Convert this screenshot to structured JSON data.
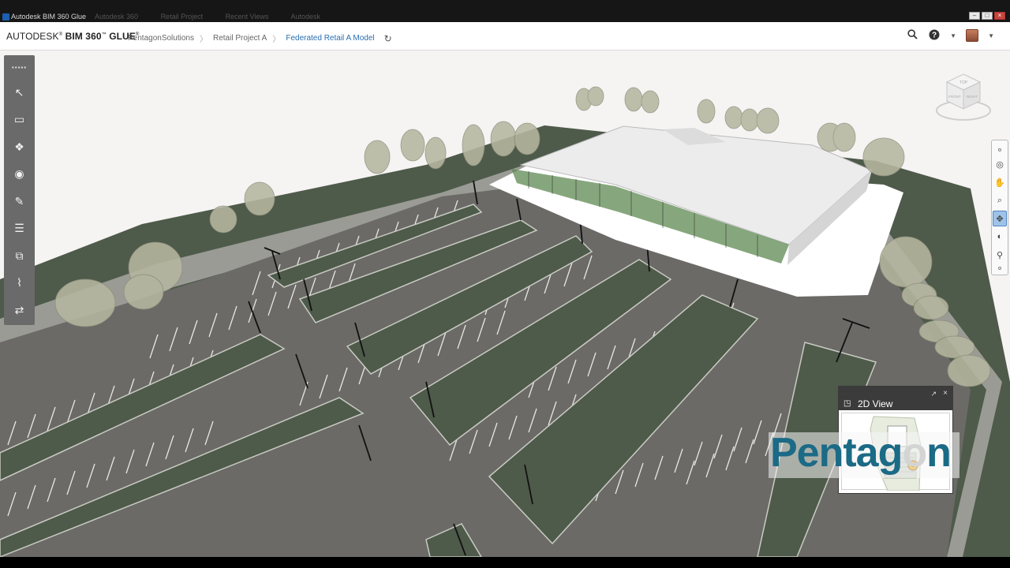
{
  "window": {
    "title": "Autodesk BIM 360 Glue",
    "ghost_tabs": [
      "Autodesk 360",
      "Retail Project",
      "Recent Views",
      "Autodesk"
    ],
    "controls": [
      "–",
      "□",
      "×"
    ]
  },
  "header": {
    "brand_prefix": "AUTODESK",
    "brand_product": "BIM 360",
    "brand_suffix": "GLUE",
    "breadcrumbs": [
      "PentagonSolutions",
      "Retail Project A",
      "Federated Retail A Model"
    ]
  },
  "icons": {
    "refresh": "refresh-icon",
    "search": "search-icon",
    "help": "help-icon",
    "avatar": "user-avatar"
  },
  "left_toolbar": {
    "tools": [
      {
        "name": "select-tool",
        "glyph": "↖"
      },
      {
        "name": "measure-tool",
        "glyph": "▭"
      },
      {
        "name": "explode-tool",
        "glyph": "❖"
      },
      {
        "name": "visibility-tool",
        "glyph": "◉"
      },
      {
        "name": "markup-tool",
        "glyph": "✎"
      },
      {
        "name": "model-browser-tool",
        "glyph": "☰"
      },
      {
        "name": "views-tool",
        "glyph": "⧉"
      },
      {
        "name": "clash-tool",
        "glyph": "⌇"
      },
      {
        "name": "share-tool",
        "glyph": "⇄"
      }
    ]
  },
  "right_nav": {
    "tools": [
      {
        "name": "full-navigation-wheel",
        "glyph": "◎"
      },
      {
        "name": "pan-tool",
        "glyph": "✋"
      },
      {
        "name": "zoom-tool",
        "glyph": "⌕"
      },
      {
        "name": "orbit-tool",
        "glyph": "✥"
      },
      {
        "name": "look-tool",
        "glyph": "◐"
      },
      {
        "name": "walk-tool",
        "glyph": "⚲"
      }
    ],
    "active_index": 3
  },
  "navcube": {
    "faces": [
      "TOP",
      "FRONT",
      "RIGHT"
    ]
  },
  "view2d": {
    "title": "2D View",
    "pop_out": "↗",
    "close": "×"
  },
  "watermark": {
    "text_a": "Pentag",
    "text_o": "o",
    "text_b": "n"
  },
  "colors": {
    "asphalt": "#6b6a67",
    "grass": "#4e5a4a",
    "tree": "#b6b7a0",
    "accent": "#2a6fb0",
    "watermark": "#1b6a86"
  }
}
